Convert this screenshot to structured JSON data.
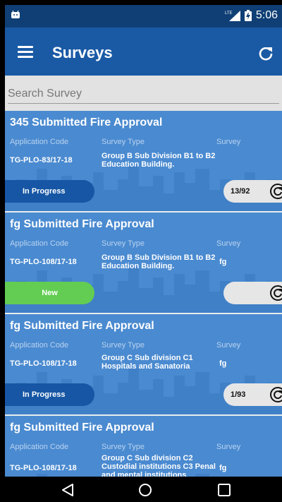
{
  "status_bar": {
    "signal": "LTE",
    "time": "5:06"
  },
  "app_bar": {
    "title": "Surveys"
  },
  "search": {
    "placeholder": "Search Survey"
  },
  "labels": {
    "application_code": "Application Code",
    "survey_type": "Survey Type",
    "survey": "Survey"
  },
  "cards": [
    {
      "title": "345 Submitted Fire Approval",
      "application_code": "TG-PLO-83/17-18",
      "survey_type_1": "Group B Sub Division B1 to B2",
      "survey_type_2": "Education Building.",
      "survey_type_3": "",
      "survey": "",
      "status": "In Progress",
      "count": "13/92"
    },
    {
      "title": "fg Submitted Fire Approval",
      "application_code": "TG-PLO-108/17-18",
      "survey_type_1": "Group B Sub Division B1 to B2",
      "survey_type_2": "Education Building.",
      "survey_type_3": "",
      "survey": "fg",
      "status": "New",
      "count": ""
    },
    {
      "title": "fg Submitted Fire Approval",
      "application_code": "TG-PLO-108/17-18",
      "survey_type_1": "Group C Sub division C1",
      "survey_type_2": "Hospitals and Sanatoria",
      "survey_type_3": "",
      "survey": "fg",
      "status": "In Progress",
      "count": "1/93"
    },
    {
      "title": "fg Submitted Fire Approval",
      "application_code": "TG-PLO-108/17-18",
      "survey_type_1": "Group C Sub division C2",
      "survey_type_2": "Custodial institutions C3 Penal",
      "survey_type_3": "and mental institutions",
      "survey": "fg",
      "status": "",
      "count": ""
    }
  ],
  "colors": {
    "status_bar": "#0f3f75",
    "app_bar": "#1a5aa5",
    "card_bg": "#4a8ad0",
    "pill_in_progress": "#1656a4",
    "pill_new": "#62cd52"
  }
}
